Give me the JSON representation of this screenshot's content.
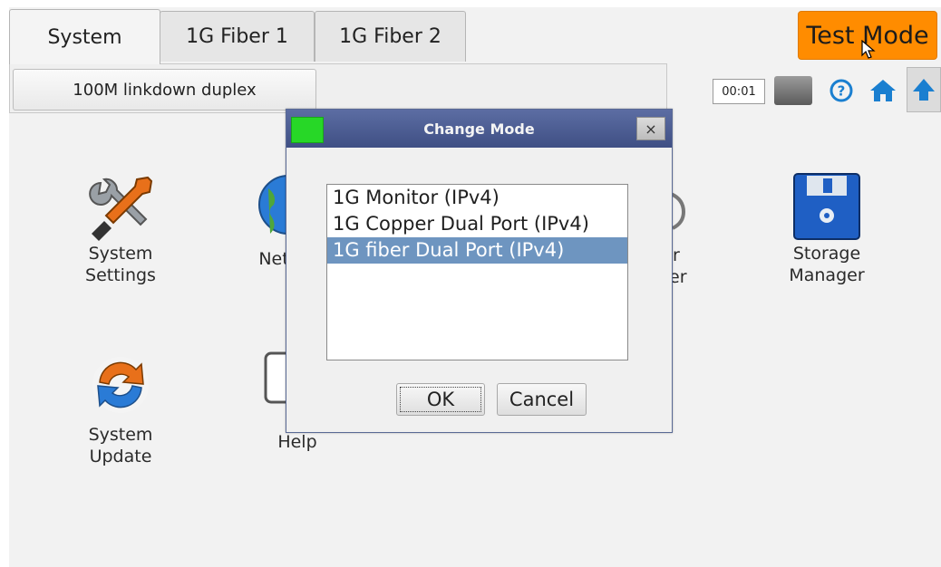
{
  "tabs": [
    {
      "label": "System",
      "active": true
    },
    {
      "label": "1G Fiber 1",
      "active": false
    },
    {
      "label": "1G Fiber 2",
      "active": false
    }
  ],
  "status_button": {
    "label": "100M linkdown duplex"
  },
  "test_mode_button": {
    "label": "Test Mode",
    "color": "#ff8c00"
  },
  "toolbar": {
    "timer": "00:01",
    "icons": [
      "battery-icon",
      "help-icon",
      "home-icon",
      "up-arrow-icon"
    ]
  },
  "apps": [
    {
      "label_line1": "System",
      "label_line2": "Settings",
      "icon": "wrench-screwdriver-icon"
    },
    {
      "label_line1": "Net",
      "icon": "globe-icon"
    },
    {
      "label_line1": "r",
      "label_line2": "er",
      "icon": "gear-icon"
    },
    {
      "label_line1": "Storage",
      "label_line2": "Manager",
      "icon": "floppy-disk-icon"
    },
    {
      "label_line1": "System",
      "label_line2": "Update",
      "icon": "refresh-icon"
    },
    {
      "label_line1": "Help",
      "icon": "help-document-icon"
    }
  ],
  "dialog": {
    "title": "Change Mode",
    "close_glyph": "×",
    "options": [
      "1G Monitor (IPv4)",
      "1G Copper Dual Port (IPv4)",
      "1G fiber Dual Port (IPv4)"
    ],
    "selected_index": 2,
    "ok_label": "OK",
    "cancel_label": "Cancel"
  }
}
